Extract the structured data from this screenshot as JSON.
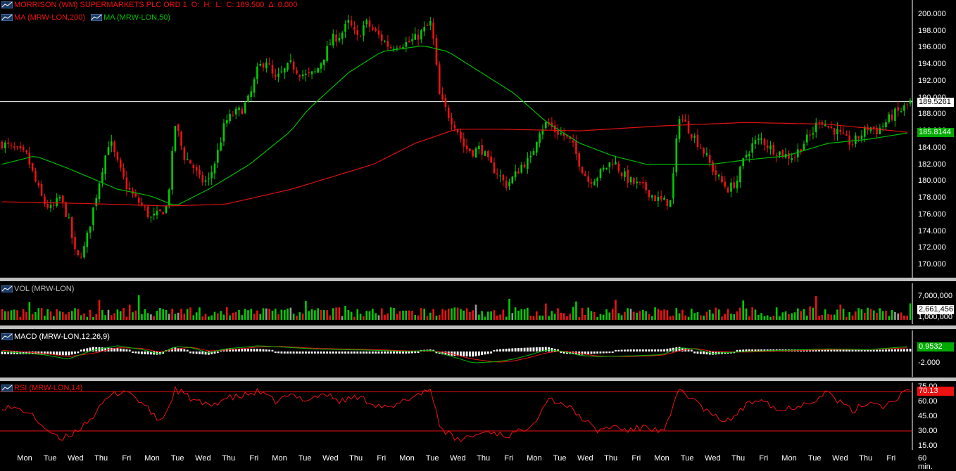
{
  "header": {
    "symbol_title": "MORRISON (WM) SUPERMARKETS PLC ORD 1",
    "o_label": "O:",
    "h_label": "H:",
    "l_label": "L:",
    "c_label": "C: 189.500",
    "chg_label": "Δ: 0.000"
  },
  "colors": {
    "up": "#00cc00",
    "down": "#ee1111",
    "ma200": "#dd1111",
    "ma50": "#00bb00",
    "neutral": "#999999",
    "bg": "#000000"
  },
  "price_pane": {
    "ma200_label": "MA (MRW-LON,200)",
    "ma50_label": "MA (MRW-LON,50)",
    "ticks": [
      "200.000",
      "198.000",
      "196.000",
      "194.000",
      "192.000",
      "190.000",
      "188.000",
      "186.000",
      "184.000",
      "182.000",
      "180.000",
      "178.000",
      "176.000",
      "174.000",
      "172.000",
      "170.000"
    ],
    "last_price_tag": "189.5261",
    "ma_tag": "185.8144"
  },
  "volume_pane": {
    "label": "VOL (MRW-LON)",
    "ticks": [
      "7,000,000",
      "1,000,000"
    ],
    "last_tag": "2,661,456"
  },
  "macd_pane": {
    "label": "MACD (MRW-LON,12,26,9)",
    "ticks": [
      "-2.000"
    ],
    "last_tag": "0.9532"
  },
  "rsi_pane": {
    "label": "RSI (MRW-LON,14)",
    "ticks": [
      "75.00",
      "60.00",
      "45.00",
      "30.00",
      "15.00"
    ],
    "last_tag": "70.13"
  },
  "x_axis": {
    "days": [
      "Mon",
      "Tue",
      "Wed",
      "Thu",
      "Fri",
      "Mon",
      "Tue",
      "Wed",
      "Thu",
      "Fri",
      "Mon",
      "Tue",
      "Wed",
      "Thu",
      "Fri",
      "Mon",
      "Tue",
      "Wed",
      "Thu",
      "Fri",
      "Mon",
      "Tue",
      "Wed",
      "Thu",
      "Fri",
      "Mon",
      "Tue",
      "Wed",
      "Thu",
      "Fri",
      "Mon",
      "Tue",
      "Wed",
      "Thu",
      "Fri"
    ],
    "interval": "60 min."
  },
  "chart_data": {
    "type": "candlestick",
    "price_range": [
      169,
      201
    ],
    "close_path": [
      [
        0,
        184.5
      ],
      [
        3,
        183.0
      ],
      [
        4,
        180.0
      ],
      [
        5,
        177.5
      ],
      [
        6,
        176.5
      ],
      [
        7,
        178.0
      ],
      [
        8,
        175.5
      ],
      [
        9,
        170.5
      ],
      [
        10,
        172.0
      ],
      [
        11,
        176.5
      ],
      [
        12,
        181.0
      ],
      [
        13,
        185.0
      ],
      [
        14,
        182.0
      ],
      [
        15,
        179.5
      ],
      [
        16,
        178.0
      ],
      [
        17,
        177.0
      ],
      [
        18,
        175.5
      ],
      [
        19,
        176.0
      ],
      [
        20,
        177.0
      ],
      [
        21,
        187.0
      ],
      [
        22,
        183.0
      ],
      [
        23,
        182.0
      ],
      [
        24,
        180.0
      ],
      [
        25,
        180.0
      ],
      [
        26,
        183.0
      ],
      [
        27,
        187.0
      ],
      [
        28,
        188.0
      ],
      [
        29,
        188.5
      ],
      [
        30,
        190.0
      ],
      [
        31,
        193.5
      ],
      [
        32,
        194.5
      ],
      [
        33,
        192.0
      ],
      [
        34,
        193.0
      ],
      [
        35,
        194.0
      ],
      [
        36,
        193.0
      ],
      [
        37,
        192.5
      ],
      [
        38,
        193.0
      ],
      [
        39,
        195.0
      ],
      [
        40,
        197.0
      ],
      [
        41,
        197.5
      ],
      [
        42,
        199.0
      ],
      [
        43,
        197.0
      ],
      [
        44,
        199.0
      ],
      [
        45,
        198.0
      ],
      [
        46,
        197.0
      ],
      [
        47,
        196.0
      ],
      [
        48,
        196.5
      ],
      [
        49,
        196.5
      ],
      [
        50,
        197.0
      ],
      [
        51,
        198.0
      ],
      [
        52,
        199.0
      ],
      [
        53,
        190.0
      ],
      [
        54,
        188.0
      ],
      [
        55,
        186.5
      ],
      [
        56,
        184.0
      ],
      [
        57,
        183.5
      ],
      [
        58,
        184.0
      ],
      [
        59,
        182.0
      ],
      [
        60,
        181.0
      ],
      [
        61,
        179.5
      ],
      [
        62,
        180.5
      ],
      [
        63,
        182.0
      ],
      [
        64,
        182.5
      ],
      [
        65,
        186.0
      ],
      [
        66,
        187.0
      ],
      [
        67,
        186.0
      ],
      [
        68,
        185.5
      ],
      [
        69,
        184.5
      ],
      [
        70,
        182.0
      ],
      [
        71,
        180.0
      ],
      [
        72,
        180.5
      ],
      [
        73,
        181.5
      ],
      [
        74,
        182.5
      ],
      [
        75,
        181.0
      ],
      [
        76,
        180.0
      ],
      [
        77,
        179.5
      ],
      [
        78,
        179.0
      ],
      [
        79,
        178.0
      ],
      [
        80,
        177.5
      ],
      [
        81,
        177.5
      ],
      [
        82,
        188.0
      ],
      [
        83,
        186.5
      ],
      [
        84,
        185.0
      ],
      [
        85,
        183.5
      ],
      [
        86,
        181.5
      ],
      [
        87,
        180.0
      ],
      [
        88,
        179.0
      ],
      [
        89,
        180.0
      ],
      [
        90,
        183.0
      ],
      [
        91,
        184.5
      ],
      [
        92,
        185.0
      ],
      [
        93,
        184.0
      ],
      [
        94,
        183.5
      ],
      [
        95,
        183.0
      ],
      [
        96,
        183.0
      ],
      [
        97,
        184.5
      ],
      [
        98,
        185.5
      ],
      [
        99,
        187.5
      ],
      [
        100,
        186.5
      ],
      [
        101,
        186.0
      ],
      [
        102,
        185.0
      ],
      [
        103,
        184.5
      ],
      [
        104,
        185.5
      ],
      [
        105,
        186.5
      ],
      [
        106,
        186.0
      ],
      [
        107,
        187.0
      ],
      [
        108,
        188.0
      ],
      [
        109,
        188.5
      ],
      [
        110,
        189.5
      ]
    ],
    "ma200_path": [
      [
        0,
        177.5
      ],
      [
        10,
        177.3
      ],
      [
        20,
        177.0
      ],
      [
        27,
        177.2
      ],
      [
        35,
        179.0
      ],
      [
        45,
        182.0
      ],
      [
        50,
        184.5
      ],
      [
        55,
        186.2
      ],
      [
        60,
        186.2
      ],
      [
        70,
        186.0
      ],
      [
        80,
        186.6
      ],
      [
        90,
        187.0
      ],
      [
        100,
        186.8
      ],
      [
        108,
        186.0
      ],
      [
        110,
        185.8
      ]
    ],
    "ma50_path": [
      [
        0,
        182.0
      ],
      [
        4,
        183.0
      ],
      [
        8,
        181.5
      ],
      [
        14,
        179.0
      ],
      [
        18,
        178.2
      ],
      [
        21,
        177.0
      ],
      [
        25,
        179.0
      ],
      [
        30,
        182.0
      ],
      [
        35,
        186.0
      ],
      [
        37,
        188.5
      ],
      [
        42,
        193.0
      ],
      [
        46,
        195.5
      ],
      [
        51,
        196.2
      ],
      [
        54,
        195.5
      ],
      [
        58,
        193.0
      ],
      [
        62,
        190.5
      ],
      [
        66,
        187.0
      ],
      [
        70,
        184.5
      ],
      [
        74,
        183.0
      ],
      [
        78,
        182.0
      ],
      [
        82,
        182.0
      ],
      [
        86,
        182.0
      ],
      [
        90,
        182.5
      ],
      [
        95,
        183.0
      ],
      [
        100,
        184.5
      ],
      [
        105,
        185.0
      ],
      [
        110,
        185.8
      ]
    ],
    "rsi_path": [
      [
        0,
        55
      ],
      [
        3,
        50
      ],
      [
        5,
        35
      ],
      [
        7,
        20
      ],
      [
        9,
        30
      ],
      [
        11,
        45
      ],
      [
        13,
        65
      ],
      [
        15,
        72
      ],
      [
        17,
        58
      ],
      [
        19,
        40
      ],
      [
        20,
        50
      ],
      [
        21,
        73
      ],
      [
        23,
        62
      ],
      [
        25,
        55
      ],
      [
        27,
        63
      ],
      [
        29,
        65
      ],
      [
        31,
        70
      ],
      [
        33,
        60
      ],
      [
        35,
        66
      ],
      [
        37,
        62
      ],
      [
        39,
        68
      ],
      [
        41,
        60
      ],
      [
        43,
        65
      ],
      [
        45,
        58
      ],
      [
        47,
        52
      ],
      [
        49,
        62
      ],
      [
        51,
        70
      ],
      [
        52,
        72
      ],
      [
        53,
        35
      ],
      [
        55,
        20
      ],
      [
        57,
        25
      ],
      [
        59,
        30
      ],
      [
        61,
        25
      ],
      [
        63,
        30
      ],
      [
        65,
        45
      ],
      [
        66,
        63
      ],
      [
        68,
        58
      ],
      [
        70,
        45
      ],
      [
        72,
        30
      ],
      [
        74,
        35
      ],
      [
        76,
        30
      ],
      [
        78,
        35
      ],
      [
        80,
        28
      ],
      [
        81,
        45
      ],
      [
        82,
        73
      ],
      [
        84,
        60
      ],
      [
        86,
        45
      ],
      [
        88,
        40
      ],
      [
        90,
        55
      ],
      [
        92,
        65
      ],
      [
        94,
        50
      ],
      [
        96,
        55
      ],
      [
        98,
        60
      ],
      [
        100,
        70
      ],
      [
        101,
        62
      ],
      [
        103,
        50
      ],
      [
        105,
        60
      ],
      [
        107,
        55
      ],
      [
        109,
        68
      ],
      [
        110,
        70
      ]
    ],
    "volume_bars": 300,
    "macd_line_path": [
      [
        0,
        0.0
      ],
      [
        5,
        -0.5
      ],
      [
        8,
        -1.2
      ],
      [
        11,
        0.2
      ],
      [
        14,
        0.9
      ],
      [
        17,
        0.3
      ],
      [
        19,
        -0.4
      ],
      [
        21,
        0.8
      ],
      [
        23,
        0.6
      ],
      [
        25,
        -0.2
      ],
      [
        27,
        0.4
      ],
      [
        31,
        0.9
      ],
      [
        34,
        0.7
      ],
      [
        38,
        0.4
      ],
      [
        41,
        0.3
      ],
      [
        45,
        0.2
      ],
      [
        49,
        0.0
      ],
      [
        52,
        0.2
      ],
      [
        54,
        -0.6
      ],
      [
        57,
        -1.8
      ],
      [
        60,
        -1.6
      ],
      [
        62,
        -1.2
      ],
      [
        64,
        -0.5
      ],
      [
        66,
        0.3
      ],
      [
        68,
        0.0
      ],
      [
        70,
        -0.6
      ],
      [
        72,
        -0.8
      ],
      [
        76,
        -0.7
      ],
      [
        80,
        -0.5
      ],
      [
        82,
        0.6
      ],
      [
        84,
        0.4
      ],
      [
        86,
        -0.3
      ],
      [
        90,
        0.0
      ],
      [
        95,
        0.2
      ],
      [
        100,
        0.4
      ],
      [
        105,
        0.3
      ],
      [
        110,
        0.8
      ]
    ],
    "macd_signal_path": [
      [
        0,
        0.2
      ],
      [
        5,
        -0.3
      ],
      [
        8,
        -0.8
      ],
      [
        11,
        -0.3
      ],
      [
        14,
        0.6
      ],
      [
        17,
        0.5
      ],
      [
        19,
        -0.1
      ],
      [
        21,
        0.4
      ],
      [
        23,
        0.7
      ],
      [
        25,
        0.1
      ],
      [
        27,
        0.2
      ],
      [
        31,
        0.7
      ],
      [
        34,
        0.8
      ],
      [
        38,
        0.5
      ],
      [
        41,
        0.4
      ],
      [
        45,
        0.3
      ],
      [
        49,
        0.1
      ],
      [
        52,
        0.1
      ],
      [
        54,
        -0.2
      ],
      [
        57,
        -1.2
      ],
      [
        60,
        -1.7
      ],
      [
        62,
        -1.5
      ],
      [
        64,
        -0.9
      ],
      [
        66,
        -0.2
      ],
      [
        68,
        0.1
      ],
      [
        70,
        -0.3
      ],
      [
        72,
        -0.7
      ],
      [
        76,
        -0.8
      ],
      [
        80,
        -0.6
      ],
      [
        82,
        0.1
      ],
      [
        84,
        0.5
      ],
      [
        86,
        0.0
      ],
      [
        90,
        -0.1
      ],
      [
        95,
        0.1
      ],
      [
        100,
        0.3
      ],
      [
        105,
        0.3
      ],
      [
        110,
        0.6
      ]
    ]
  }
}
